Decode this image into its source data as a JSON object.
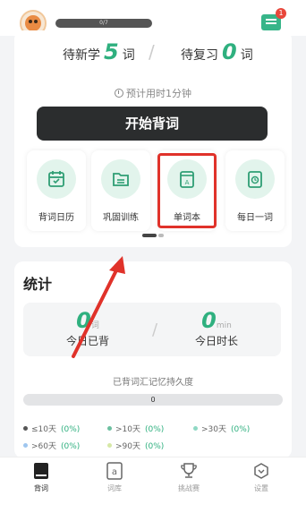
{
  "header": {
    "progress_text": "0/7",
    "message_badge": "1"
  },
  "plan": {
    "new_label": "待新学",
    "new_count": "5",
    "new_unit": "词",
    "review_label": "待复习",
    "review_count": "0",
    "review_unit": "词",
    "estimate": "预计用时1分钟",
    "start_button": "开始背词"
  },
  "features": [
    {
      "label": "背词日历",
      "icon": "calendar-icon"
    },
    {
      "label": "巩固训练",
      "icon": "folder-icon"
    },
    {
      "label": "单词本",
      "icon": "wordbook-icon"
    },
    {
      "label": "每日一词",
      "icon": "clock-card-icon"
    }
  ],
  "stats": {
    "title": "统计",
    "today_words_count": "0",
    "today_words_unit": "词",
    "today_words_label": "今日已背",
    "today_time_count": "0",
    "today_time_unit": "min",
    "today_time_label": "今日时长",
    "memory_title": "已背词汇记忆持久度",
    "memory_value": "0",
    "legend": [
      {
        "label": "≤10天",
        "pct": "(0%)",
        "color": "#555555"
      },
      {
        "label": ">10天",
        "pct": "(0%)",
        "color": "#6cc0a0"
      },
      {
        "label": ">30天",
        "pct": "(0%)",
        "color": "#8fd8c4"
      },
      {
        "label": ">60天",
        "pct": "(0%)",
        "color": "#9fc6ef"
      },
      {
        "label": ">90天",
        "pct": "(0%)",
        "color": "#d6e8a6"
      }
    ]
  },
  "tabs": [
    {
      "label": "背词",
      "icon": "book-icon",
      "active": true
    },
    {
      "label": "词库",
      "icon": "dictionary-icon",
      "active": false
    },
    {
      "label": "挑战赛",
      "icon": "trophy-icon",
      "active": false
    },
    {
      "label": "设置",
      "icon": "settings-icon",
      "active": false
    }
  ],
  "colors": {
    "accent": "#2fb07f",
    "button_dark": "#2b2d2e",
    "highlight_red": "#e0322a"
  }
}
